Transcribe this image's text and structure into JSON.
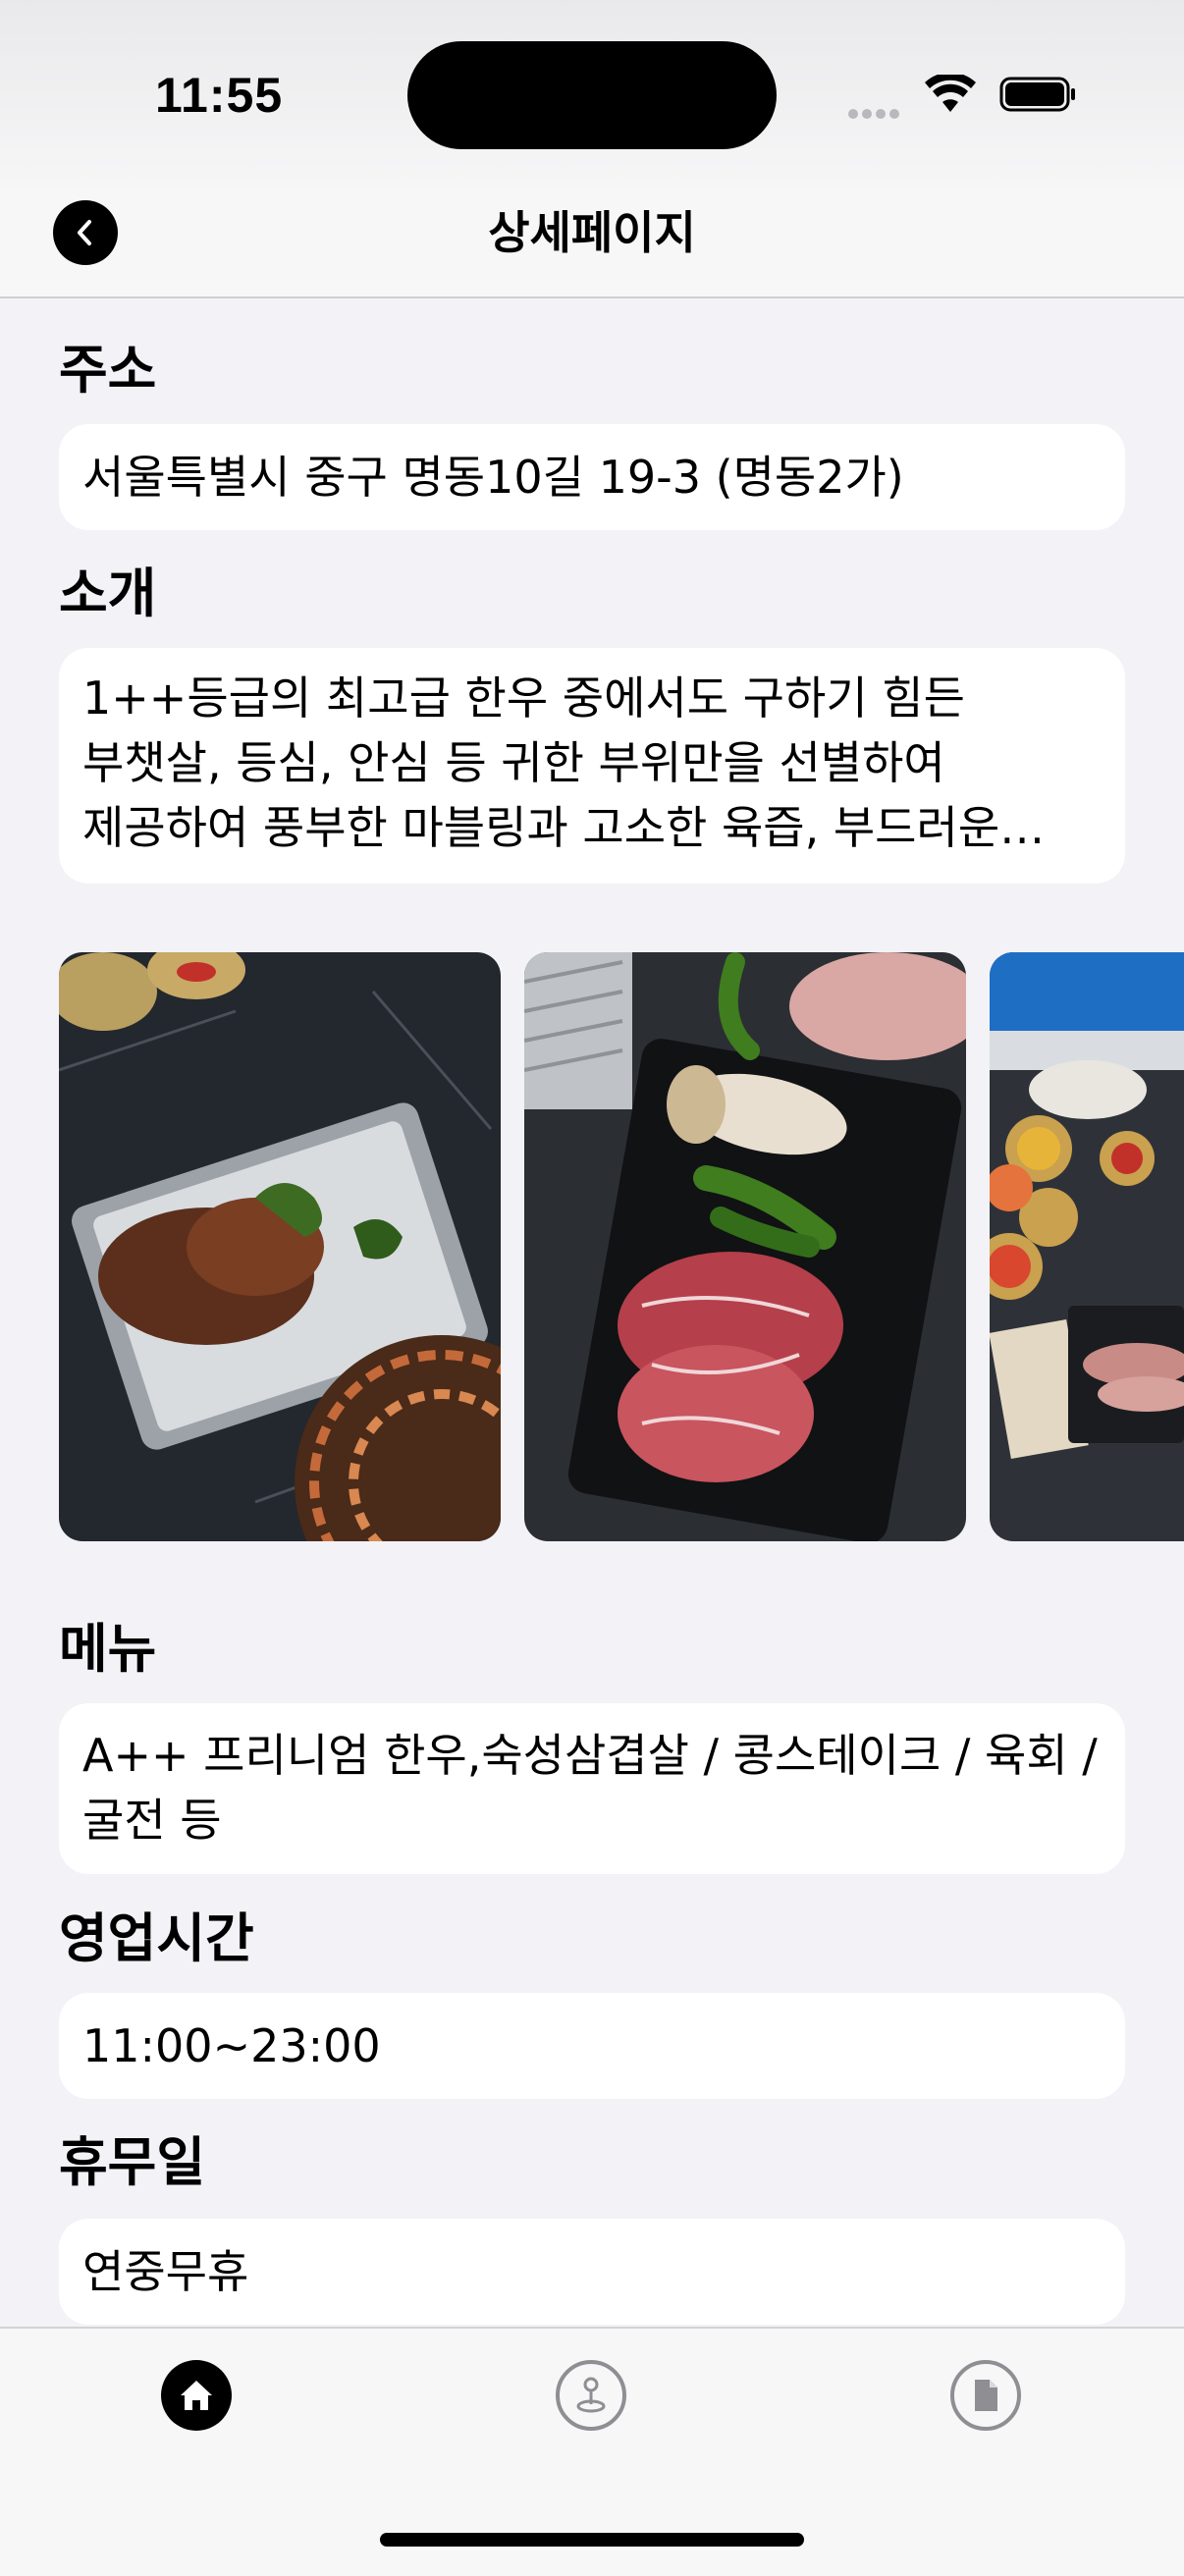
{
  "status_bar": {
    "time": "11:55"
  },
  "nav": {
    "title": "상세페이지",
    "back_icon": "chevron-left-icon"
  },
  "address": {
    "label": "주소",
    "value": "서울특별시 중구 명동10길 19-3 (명동2가)"
  },
  "intro": {
    "label": "소개",
    "lines": [
      "1++등급의 최고급 한우 중에서도 구하기 힘든",
      "부챗살, 등심, 안심 등 귀한 부위만을 선별하여",
      "제공하여 풍부한 마블링과 고소한 육즙, 부드러운…"
    ]
  },
  "menu": {
    "label": "메뉴",
    "lines": [
      "A++ 프리니엄 한우,숙성삼겹살 / 콩스테이크 / 육회 /",
      "굴전 등"
    ]
  },
  "hours": {
    "label": "영업시간",
    "value": "11:00~23:00"
  },
  "holiday": {
    "label": "휴무일",
    "value": "연중무휴"
  },
  "tabs": [
    {
      "icon": "home-icon",
      "active": true
    },
    {
      "icon": "joystick-icon",
      "active": false
    },
    {
      "icon": "document-icon",
      "active": false
    }
  ],
  "colors": {
    "background": "#f2f2f7",
    "card": "#ffffff",
    "active_tab": "#000000",
    "inactive_tab": "#8e8e93"
  }
}
